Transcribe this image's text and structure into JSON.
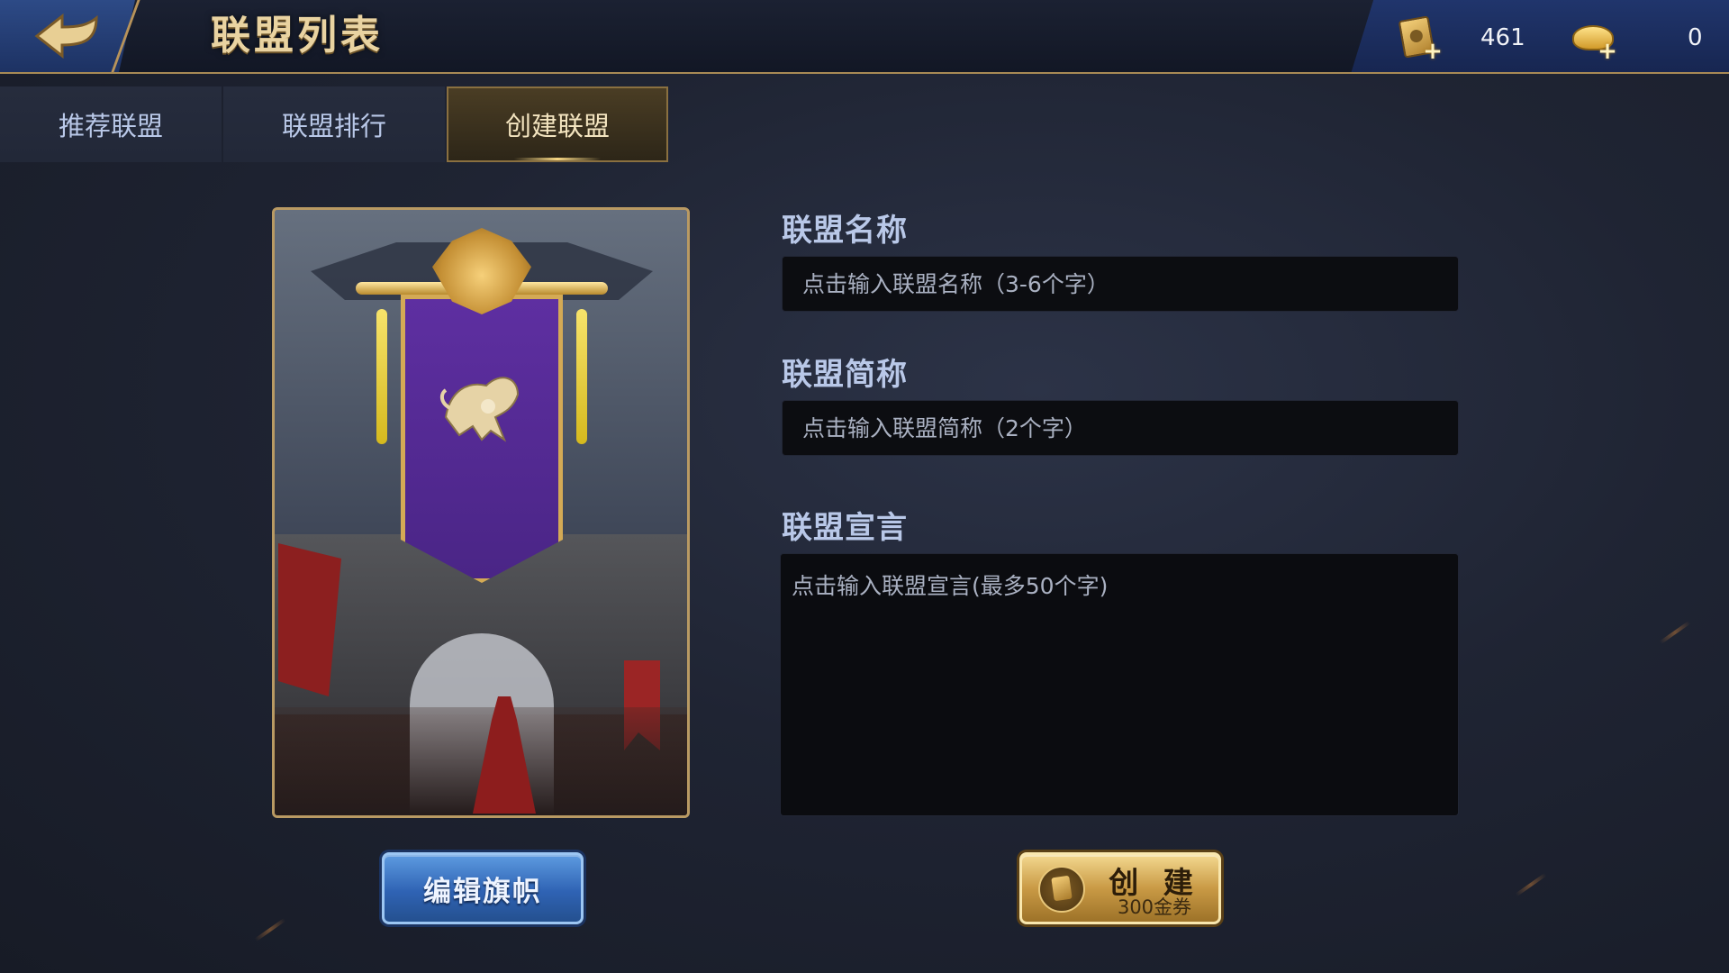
{
  "header": {
    "title": "联盟列表",
    "back_icon": "back-arrow-icon"
  },
  "currency": {
    "coupon_value": "461",
    "coupon_icon": "gold-coupon-icon",
    "ingot_value": "0",
    "ingot_icon": "gold-ingot-icon",
    "plus": "+"
  },
  "tabs": [
    {
      "label": "推荐联盟",
      "active": false
    },
    {
      "label": "联盟排行",
      "active": false
    },
    {
      "label": "创建联盟",
      "active": true
    }
  ],
  "form": {
    "name_label": "联盟名称",
    "name_placeholder": "点击输入联盟名称（3-6个字）",
    "abbr_label": "联盟简称",
    "abbr_placeholder": "点击输入联盟简称（2个字）",
    "manifesto_label": "联盟宣言",
    "manifesto_placeholder": "点击输入联盟宣言(最多50个字)"
  },
  "buttons": {
    "edit_banner": "编辑旗帜",
    "create": "创 建",
    "create_cost": "300金券"
  },
  "colors": {
    "accent_gold": "#b99a63",
    "banner_purple": "#5e2fa1",
    "edit_button_blue": "#2f63b4",
    "create_button_gold": "#c99a45"
  }
}
